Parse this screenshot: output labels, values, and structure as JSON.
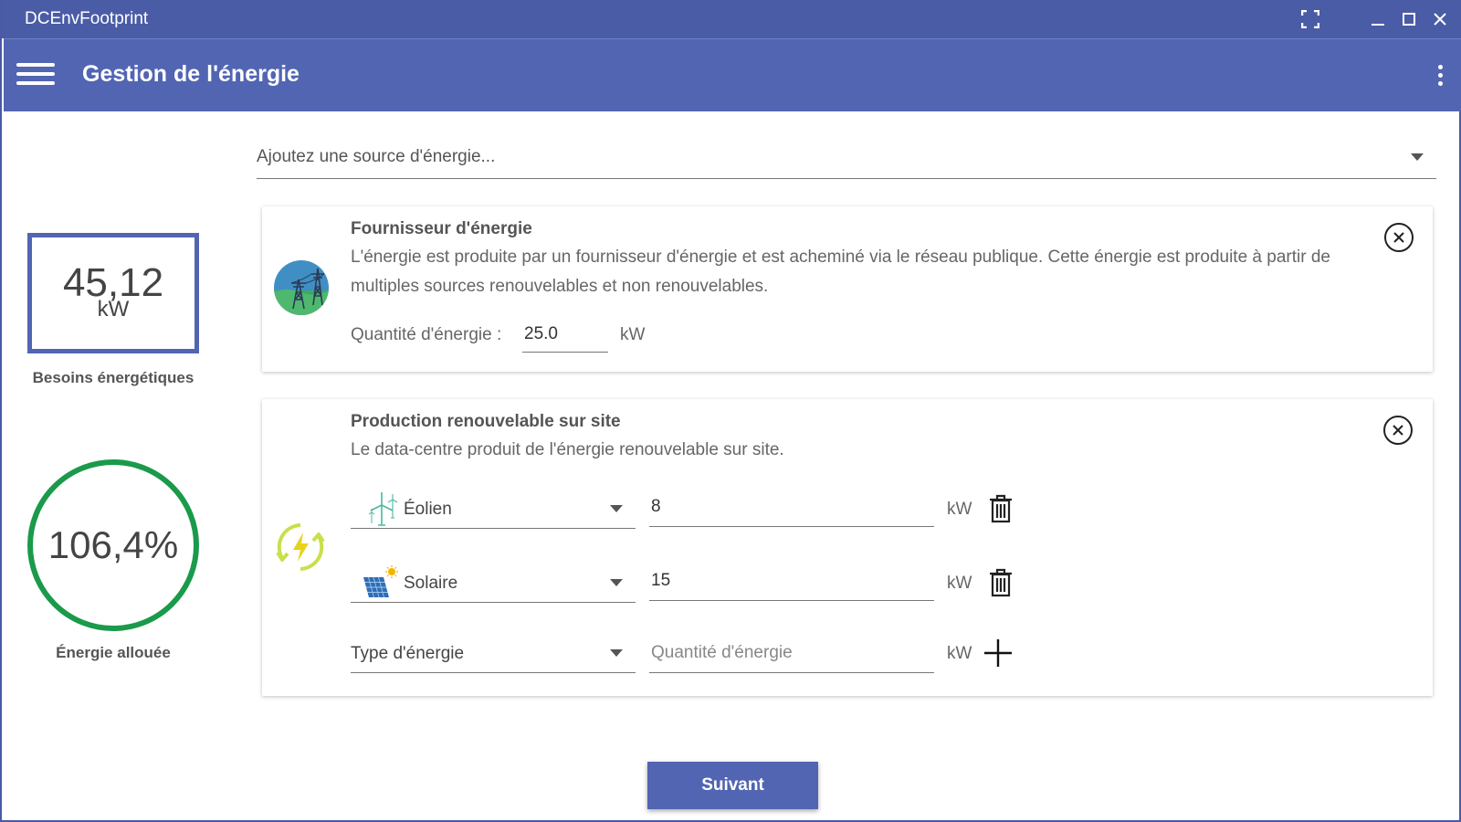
{
  "window": {
    "title": "DCEnvFootprint"
  },
  "appbar": {
    "title": "Gestion de l'énergie"
  },
  "left_panel": {
    "needs": {
      "value": "45,12",
      "unit": "kW",
      "label": "Besoins énergétiques"
    },
    "allocated": {
      "value": "106,4%",
      "label": "Énergie allouée"
    }
  },
  "source_select": {
    "placeholder": "Ajoutez une source d'énergie..."
  },
  "provider_card": {
    "title": "Fournisseur d'énergie",
    "description": "L'énergie est produite par un fournisseur d'énergie et est acheminé via le réseau publique. Cette énergie est produite à partir de multiples sources renouvelables et non renouvelables.",
    "quantity_label": "Quantité d'énergie :",
    "quantity_value": "25.0",
    "unit": "kW"
  },
  "onsite_card": {
    "title": "Production renouvelable sur site",
    "description": "Le data-centre produit de l'énergie renouvelable sur site.",
    "rows": [
      {
        "type": "Éolien",
        "icon": "wind-turbine-icon",
        "quantity": "8",
        "unit": "kW"
      },
      {
        "type": "Solaire",
        "icon": "solar-panel-icon",
        "quantity": "15",
        "unit": "kW"
      }
    ],
    "new_row": {
      "type_placeholder": "Type d'énergie",
      "quantity_placeholder": "Quantité d'énergie",
      "unit": "kW"
    }
  },
  "actions": {
    "next_label": "Suivant"
  },
  "colors": {
    "primary": "#5265b3",
    "titlebar": "#4a5ca6",
    "ring": "#1a9a4a",
    "renew_icon": "#c8e04a"
  }
}
